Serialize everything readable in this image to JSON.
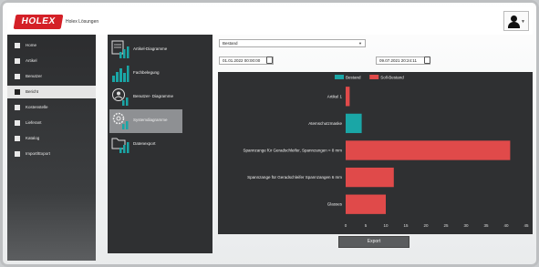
{
  "header": {
    "logo_text": "HOLEX",
    "logo_subtitle": "Holex Lösungen"
  },
  "sidebar": {
    "items": [
      {
        "label": "Home"
      },
      {
        "label": "Artikel"
      },
      {
        "label": "Benutzer"
      },
      {
        "label": "Bericht"
      },
      {
        "label": "Kostenstelle"
      },
      {
        "label": "Lieferant"
      },
      {
        "label": "Katalog"
      },
      {
        "label": "Import/Export"
      }
    ],
    "active_index": 3
  },
  "reports": {
    "items": [
      {
        "label": "Artikel-Diagramme"
      },
      {
        "label": "Fachbelegung"
      },
      {
        "label": "Benutzer- Diagramme"
      },
      {
        "label": "Systemdiagramme"
      },
      {
        "label": "Datenexport"
      }
    ],
    "active_index": 3
  },
  "filters": {
    "select_value": "Bestand",
    "date_from": "01.01.2022 00:00:00",
    "date_to": "09.07.2021 20:24:11"
  },
  "chart_data": {
    "type": "bar",
    "orientation": "horizontal",
    "categories": [
      "Artikel 1",
      "Atemschutzmaske",
      "Spannzange für Geradschleifer, Spannzangen ≈ 8 mm",
      "Spannzange für Geradschleifer Spannzangen 6 mm",
      "Glasses"
    ],
    "series": [
      {
        "name": "Bestand",
        "color": "#1aa6a6",
        "values": [
          0,
          4,
          0,
          0,
          0
        ]
      },
      {
        "name": "Soll-Bestand",
        "color": "#e04a4a",
        "values": [
          1,
          0,
          41,
          12,
          10
        ]
      }
    ],
    "xticks": [
      "0",
      "5",
      "10",
      "15",
      "20",
      "25",
      "30",
      "35",
      "40",
      "45"
    ],
    "xlim": [
      0,
      45
    ],
    "legend_position": "top-center"
  },
  "actions": {
    "export_label": "Export"
  }
}
